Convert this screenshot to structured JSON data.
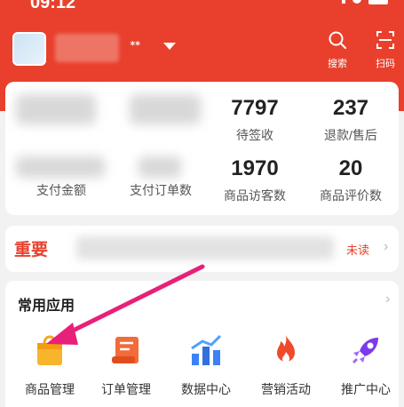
{
  "status_bar": {
    "time": "09:12"
  },
  "header": {
    "shop_suffix": "ᕯ",
    "search_label": "搜索",
    "scan_label": "扫码",
    "accent_color": "#e8402c"
  },
  "stats": [
    {
      "value": "",
      "label": "支付金额"
    },
    {
      "value": "",
      "label": "支付订单数"
    },
    {
      "value": "7797",
      "label": "待签收"
    },
    {
      "value": "237",
      "label": "退款/售后"
    },
    {
      "value": "1970",
      "label": "商品访客数"
    },
    {
      "value": "20",
      "label": "商品评价数"
    }
  ],
  "notice": {
    "tag": "重要",
    "status": "未读"
  },
  "apps": {
    "title": "常用应用",
    "items": [
      {
        "label": "商品管理",
        "icon": "shopping-bag-icon"
      },
      {
        "label": "订单管理",
        "icon": "order-scroll-icon"
      },
      {
        "label": "数据中心",
        "icon": "bar-chart-icon"
      },
      {
        "label": "营销活动",
        "icon": "fire-icon"
      },
      {
        "label": "推广中心",
        "icon": "rocket-icon"
      }
    ]
  }
}
